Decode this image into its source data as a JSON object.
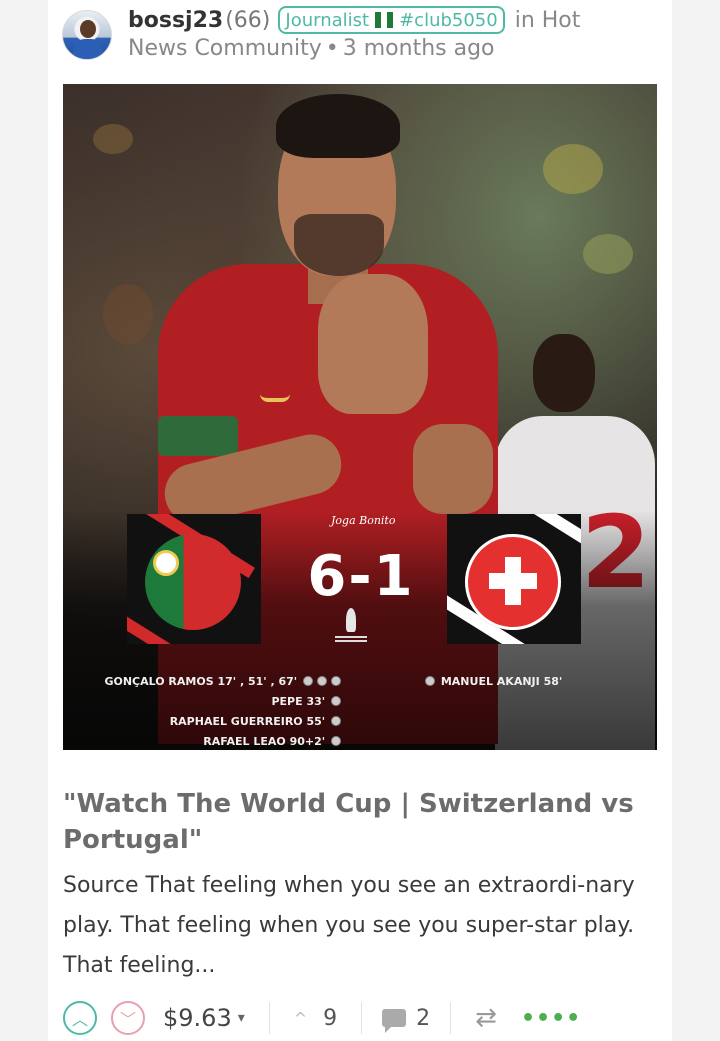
{
  "post": {
    "author": "bossj23",
    "reputation": "(66)",
    "badge_text": "Journalist",
    "badge_tag": "#club5050",
    "community_prefix": "in Hot",
    "community_name": "News Community",
    "separator": "•",
    "age": "3 months ago",
    "title": "\"Watch The World Cup | Switzerland vs Portugal\"",
    "excerpt": "Source That feeling when you see an extraordi-nary play. That feeling when you see you super-star play. That feeling..."
  },
  "poster": {
    "brand_text": "Joga Bonito",
    "score": "6-1",
    "scorers_left": [
      "GONÇALO RAMOS 17' , 51' , 67'",
      "PEPE 33'",
      "RAPHAEL GUERREIRO 55'",
      "RAFAEL LEAO 90+2'"
    ],
    "scorer_right": "MANUEL AKANJI 58'",
    "jersey_number": "2"
  },
  "actions": {
    "upvote_icon": "chevron-up-circle-icon",
    "downvote_icon": "chevron-down-circle-icon",
    "payout": "$9.63",
    "payout_caret": "▾",
    "vote_caret": "^",
    "votes": "9",
    "comments": "2",
    "reblog_icon": "⇄",
    "more_icon": "••••"
  },
  "colors": {
    "accent_teal": "#4fb9a8",
    "downvote_pink": "#e4a3ae",
    "more_green": "#4cae4c"
  }
}
